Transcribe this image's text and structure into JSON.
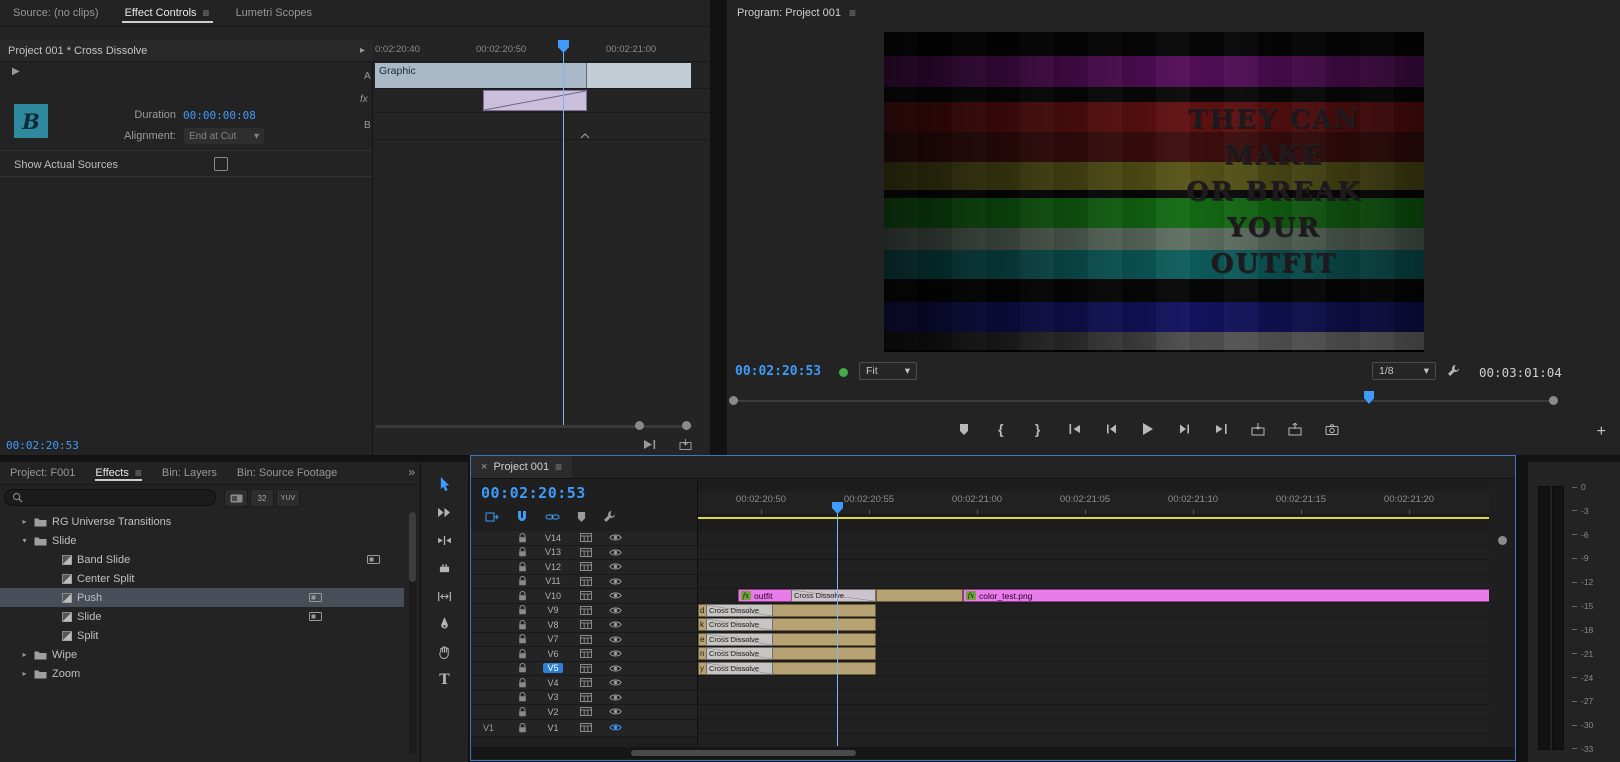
{
  "glyphs": {
    "menu": "≡",
    "overflow": "»",
    "close": "×",
    "caret": "▾",
    "expand_right": "▸",
    "play": "▶",
    "mark_in": "{",
    "mark_out": "}",
    "plus": "+",
    "type_tool": "T"
  },
  "colors": {
    "accent_blue": "#3f9bfa",
    "selection_blue": "#2f7fd6",
    "clip_pink": "#e87ce8",
    "clip_tan": "#b7a273",
    "transition_lavender": "#cbbfdc",
    "workarea_yellow": "#ddd838",
    "preview_teal": "#2f8aa0",
    "status_green": "#3fae4a"
  },
  "effect_controls": {
    "tabs": [
      {
        "label": "Source: (no clips)",
        "active": false,
        "has_menu": false
      },
      {
        "label": "Effect Controls",
        "active": true,
        "has_menu": true
      },
      {
        "label": "Lumetri Scopes",
        "active": false,
        "has_menu": false
      }
    ],
    "breadcrumb": "Project 001 * Cross Dissolve",
    "preview_letter": "B",
    "duration_label": "Duration",
    "duration_value": "00:00:00:08",
    "alignment_label": "Alignment:",
    "alignment_value": "End at Cut",
    "show_actual_sources_label": "Show Actual Sources",
    "playhead_timecode": "00:02:20:53",
    "mini_timeline": {
      "ruler_ticks": [
        "0:02:20:40",
        "00:02:20:50",
        "00:02:21:00"
      ],
      "track_a_label": "A",
      "fx_row_label": "fx",
      "track_b_label": "B",
      "clip_label": "Graphic"
    }
  },
  "program_monitor": {
    "title": "Program: Project 001",
    "overlay_lines": [
      "THEY CAN",
      "MAKE",
      "OR BREAK",
      "YOUR",
      "OUTFIT"
    ],
    "playhead_timecode": "00:02:20:53",
    "zoom_level": "Fit",
    "playback_resolution": "1/8",
    "out_timecode": "00:03:01:04"
  },
  "project_panel": {
    "tabs": [
      {
        "label": "Project: F001",
        "active": false,
        "has_menu": false
      },
      {
        "label": "Effects",
        "active": true,
        "has_menu": true
      },
      {
        "label": "Bin: Layers",
        "active": false,
        "has_menu": false
      },
      {
        "label": "Bin: Source Footage",
        "active": false,
        "has_menu": false
      }
    ],
    "filter_badges": {
      "bit32": "32",
      "yuv": "YUV"
    },
    "tree": [
      {
        "label": "RG Universe Transitions",
        "folder": true,
        "chevron": "▸"
      },
      {
        "label": "Slide",
        "folder": true,
        "chevron": "▾"
      },
      {
        "label": "Band Slide",
        "effect": true,
        "indent2": true,
        "badge": true,
        "far": true
      },
      {
        "label": "Center Split",
        "effect": true,
        "indent2": true
      },
      {
        "label": "Push",
        "effect": true,
        "indent2": true,
        "badge": true,
        "selected": true
      },
      {
        "label": "Slide",
        "effect": true,
        "indent2": true,
        "badge": true
      },
      {
        "label": "Split",
        "effect": true,
        "indent2": true
      },
      {
        "label": "Wipe",
        "folder": true,
        "chevron": "▸"
      },
      {
        "label": "Zoom",
        "folder": true,
        "chevron": "▸"
      }
    ]
  },
  "timeline": {
    "tab_label": "Project 001",
    "playhead_timecode": "00:02:20:53",
    "ruler_ticks": [
      "00:02:20:50",
      "00:02:20:55",
      "00:02:21:00",
      "00:02:21:05",
      "00:02:21:10",
      "00:02:21:15",
      "00:02:21:20"
    ],
    "tracks": [
      {
        "name": "V14"
      },
      {
        "name": "V13"
      },
      {
        "name": "V12"
      },
      {
        "name": "V11"
      },
      {
        "name": "V10"
      },
      {
        "name": "V9"
      },
      {
        "name": "V8"
      },
      {
        "name": "V7"
      },
      {
        "name": "V6"
      },
      {
        "name": "V5",
        "selected": true
      },
      {
        "name": "V4"
      },
      {
        "name": "V3"
      },
      {
        "name": "V2"
      },
      {
        "name": "V1",
        "source": "V1",
        "output_off": true,
        "tall": true
      }
    ],
    "clips": {
      "fx_badge": "fx",
      "outfit_label": "outfit",
      "color_test_label": "color_test.png",
      "top_transition": "Cross Dissolve"
    },
    "dissolve_rows": [
      {
        "fragment": "d",
        "transition": "Cross Dissolve"
      },
      {
        "fragment": "k",
        "transition": "Cross Dissolve"
      },
      {
        "fragment": "e",
        "transition": "Cross Dissolve"
      },
      {
        "fragment": "n",
        "transition": "Cross Dissolve"
      },
      {
        "fragment": "y",
        "transition": "Cross Dissolve"
      }
    ]
  },
  "audio_meter": {
    "ticks": [
      "0",
      "-3",
      "-6",
      "-9",
      "-12",
      "-15",
      "-18",
      "-21",
      "-24",
      "-27",
      "-30",
      "-33"
    ]
  }
}
